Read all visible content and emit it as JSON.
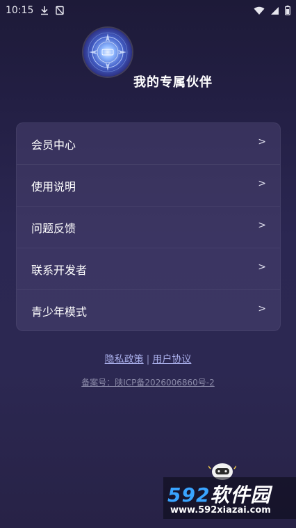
{
  "status_bar": {
    "time": "10:15",
    "icons_left": [
      "download-icon",
      "image-off-icon"
    ],
    "icons_right": [
      "wifi-icon",
      "signal-icon",
      "battery-icon"
    ]
  },
  "header": {
    "avatar_icon": "app-logo",
    "title": "我的专属伙伴"
  },
  "menu": {
    "items": [
      {
        "label": "会员中心",
        "chevron": ">"
      },
      {
        "label": "使用说明",
        "chevron": ">"
      },
      {
        "label": "问题反馈",
        "chevron": ">"
      },
      {
        "label": "联系开发者",
        "chevron": ">"
      },
      {
        "label": "青少年模式",
        "chevron": ">"
      }
    ]
  },
  "footer": {
    "privacy_link": "隐私政策",
    "separator": "|",
    "user_agreement_link": "用户协议",
    "icp": "备案号：陕ICP备2026006860号-2"
  },
  "watermark": {
    "brand_num": "592",
    "brand_cn": "软件园",
    "url": "www.592xiazai.com"
  },
  "colors": {
    "background_top": "#1d1a38",
    "background_bottom": "#2c2852",
    "card": "#484270",
    "link": "#a9aeea"
  }
}
